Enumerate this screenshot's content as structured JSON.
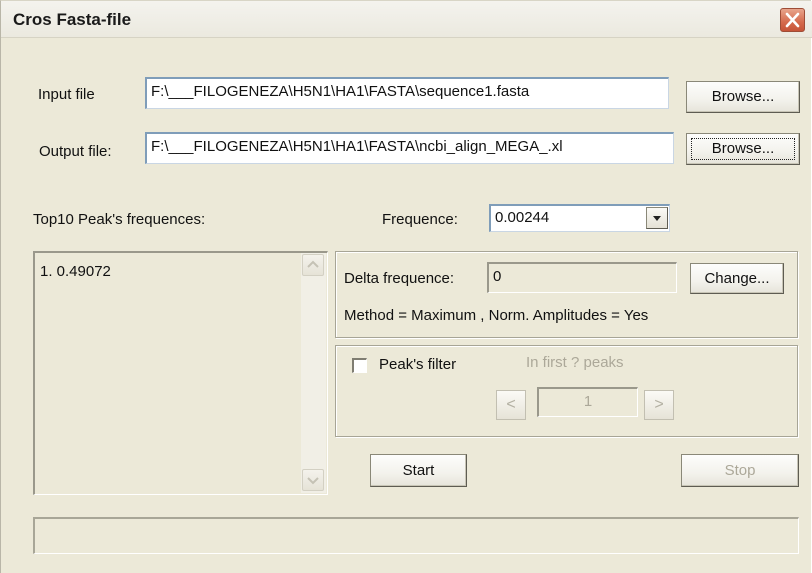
{
  "window": {
    "title": "Cros Fasta-file"
  },
  "input_file": {
    "label": "Input file",
    "value": "F:\\___FILOGENEZA\\H5N1\\HA1\\FASTA\\sequence1.fasta",
    "browse_label": "Browse..."
  },
  "output_file": {
    "label": "Output file:",
    "value": "F:\\___FILOGENEZA\\H5N1\\HA1\\FASTA\\ncbi_align_MEGA_.xl",
    "browse_label": "Browse..."
  },
  "peaks": {
    "label": "Top10 Peak's frequences:",
    "items": [
      "1. 0.49072"
    ]
  },
  "frequence": {
    "label": "Frequence:",
    "selected": "0.00244"
  },
  "delta": {
    "label": "Delta frequence:",
    "value": "0",
    "change_label": "Change...",
    "method_text": "Method = Maximum , Norm. Amplitudes = Yes"
  },
  "filter": {
    "checkbox_label": "Peak's filter",
    "checked": false,
    "first_peaks_label": "In first ? peaks",
    "spin_value": "1",
    "prev_glyph": "<",
    "next_glyph": ">"
  },
  "actions": {
    "start_label": "Start",
    "stop_label": "Stop"
  },
  "status": {
    "text": ""
  }
}
